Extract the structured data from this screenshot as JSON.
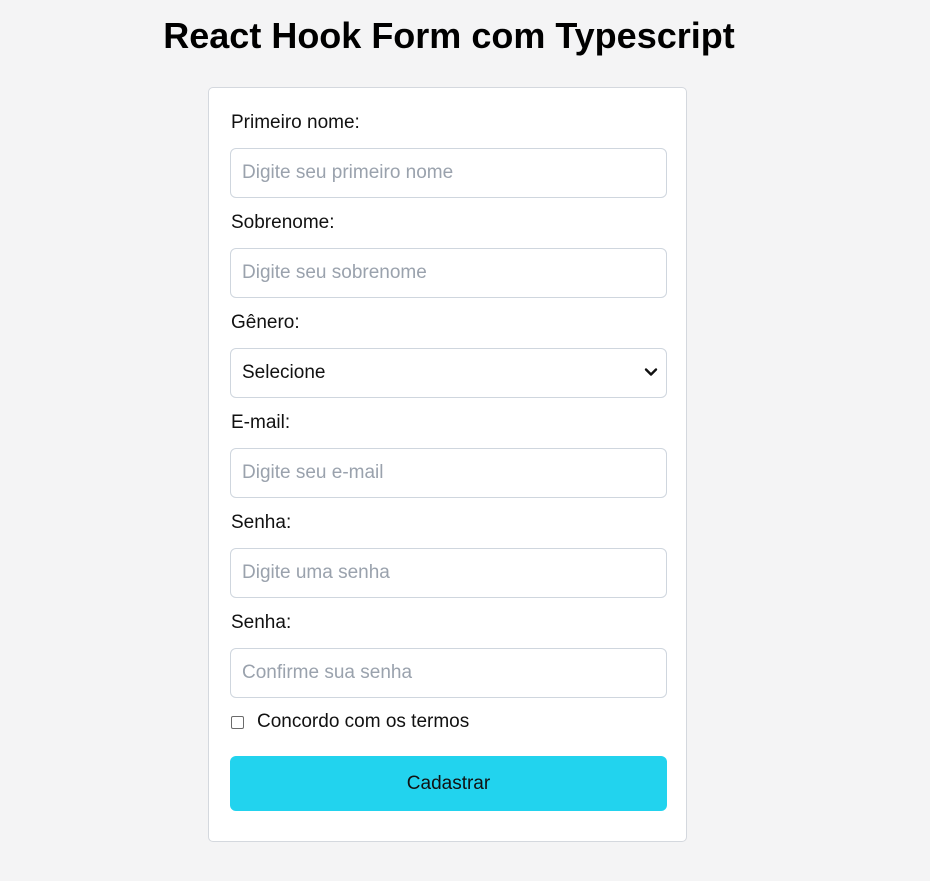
{
  "page": {
    "title": "React Hook Form com Typescript"
  },
  "form": {
    "first_name": {
      "label": "Primeiro nome:",
      "placeholder": "Digite seu primeiro nome",
      "value": ""
    },
    "last_name": {
      "label": "Sobrenome:",
      "placeholder": "Digite seu sobrenome",
      "value": ""
    },
    "gender": {
      "label": "Gênero:",
      "selected": "Selecione"
    },
    "email": {
      "label": "E-mail:",
      "placeholder": "Digite seu e-mail",
      "value": ""
    },
    "password": {
      "label": "Senha:",
      "placeholder": "Digite uma senha",
      "value": ""
    },
    "password_confirm": {
      "label": "Senha:",
      "placeholder": "Confirme sua senha",
      "value": ""
    },
    "terms": {
      "label": "Concordo com os termos",
      "checked": false
    },
    "submit_label": "Cadastrar"
  },
  "colors": {
    "background": "#f4f4f5",
    "card": "#ffffff",
    "border": "#cfd6de",
    "button": "#22d3ee",
    "placeholder": "#9aa2ad"
  },
  "icons": {
    "select_arrow": "chevron-down-icon"
  }
}
